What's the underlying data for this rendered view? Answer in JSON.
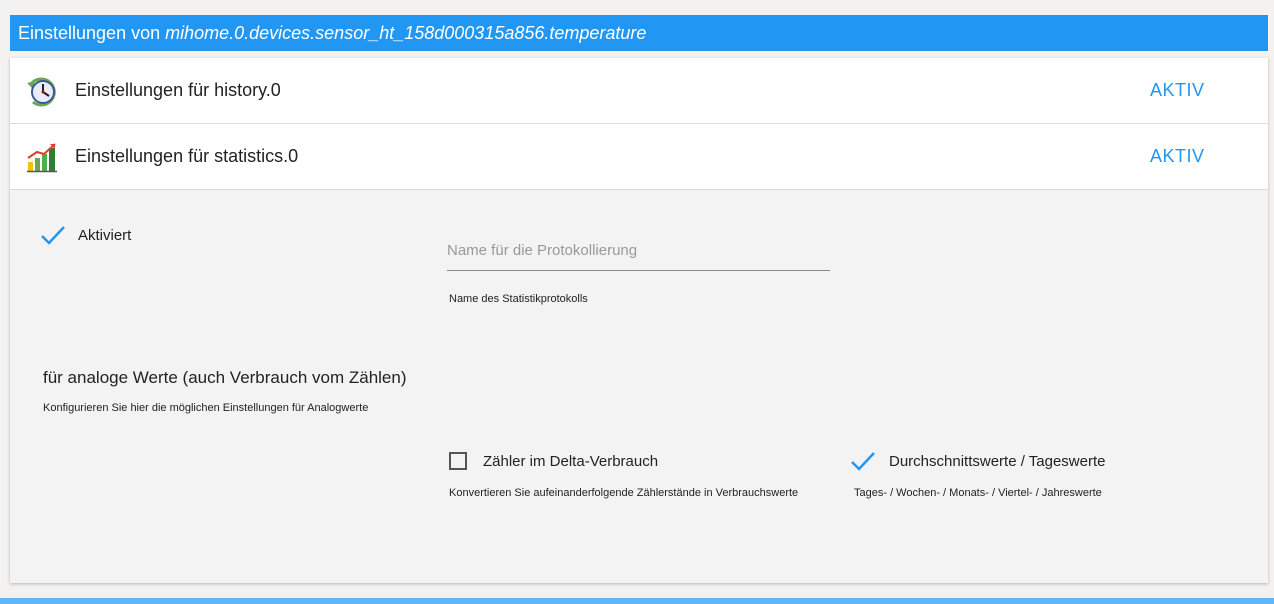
{
  "header": {
    "prefix": "Einstellungen von",
    "object_id": "mihome.0.devices.sensor_ht_158d000315a856.temperature",
    "color": "#2196f3"
  },
  "adapters": [
    {
      "icon": "history-clock-icon",
      "label": "Einstellungen für history.0",
      "status": "AKTIV"
    },
    {
      "icon": "statistics-chart-icon",
      "label": "Einstellungen für statistics.0",
      "status": "AKTIV"
    }
  ],
  "statistics": {
    "enabled_label": "Aktiviert",
    "enabled": true,
    "log_name": {
      "value": "",
      "placeholder": "Name für die Protokollierung",
      "helper": "Name des Statistikprotokolls"
    },
    "analog_section": {
      "title": "für analoge Werte (auch Verbrauch vom Zählen)",
      "description": "Konfigurieren Sie hier die möglichen Einstellungen für Analogwerte"
    },
    "counter_delta": {
      "label": "Zähler im Delta-Verbrauch",
      "checked": false,
      "helper": "Konvertieren Sie aufeinanderfolgende Zählerstände in Verbrauchswerte"
    },
    "average_values": {
      "label": "Durchschnittswerte / Tageswerte",
      "checked": true,
      "helper": "Tages- / Wochen- / Monats- / Viertel- / Jahreswerte"
    }
  }
}
